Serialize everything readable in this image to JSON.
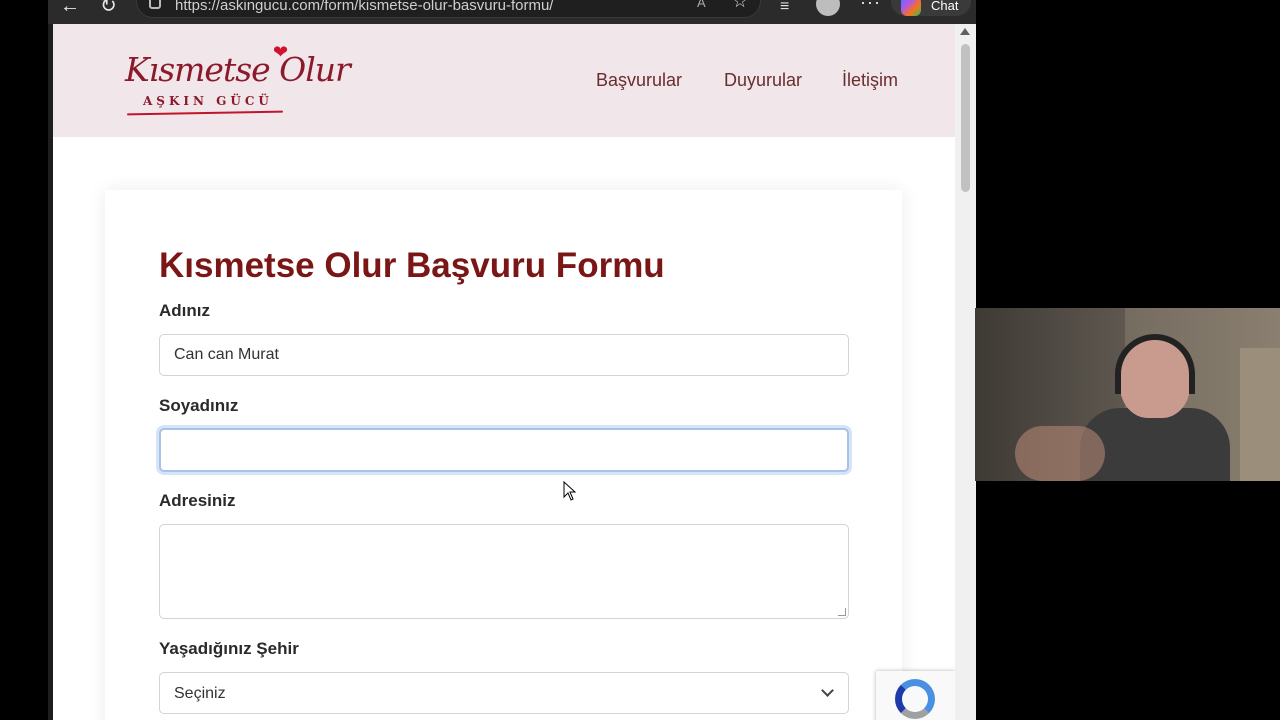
{
  "browser": {
    "url": "https://askingucu.com/form/kismetse-olur-basvuru-formu/",
    "chat_label": "Chat",
    "icons": [
      "back-icon",
      "reload-icon",
      "lock-icon",
      "read-aloud-icon",
      "favorite-star-icon",
      "extensions-icon",
      "profile-icon",
      "more-icon",
      "copilot-icon"
    ]
  },
  "site": {
    "logo_script": "Kısmetse Olur",
    "logo_sub": "AŞKIN GÜCÜ",
    "nav": [
      "Başvurular",
      "Duyurular",
      "İletişim"
    ]
  },
  "form": {
    "title": "Kısmetse Olur Başvuru Formu",
    "first_name_label": "Adınız",
    "first_name_value": "Can can Murat",
    "last_name_label": "Soyadınız",
    "last_name_value": "",
    "address_label": "Adresiniz",
    "address_value": "",
    "city_label": "Yaşadığınız Şehir",
    "city_value": "Seçiniz"
  },
  "colors": {
    "header_bg": "#f1e6ea",
    "title": "#7a1616",
    "nav": "#6a2d2d",
    "logo": "#8b1a2b",
    "focus_ring": "#a9c2e8"
  }
}
